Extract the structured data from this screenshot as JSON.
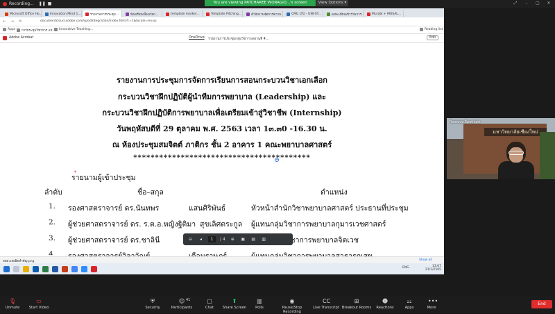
{
  "zoom": {
    "recording": "Recording...",
    "viewing_banner": "You are viewing PATCHAREE WORAGID...'s screen",
    "view_options": "View Options",
    "toolbar": [
      {
        "label": "Unmute",
        "icon": "mic-off-icon"
      },
      {
        "label": "Start Video",
        "icon": "video-off-icon"
      },
      {
        "label": "Security",
        "icon": "shield-icon"
      },
      {
        "label": "Participants",
        "icon": "people-icon",
        "count": "41"
      },
      {
        "label": "Chat",
        "icon": "chat-icon"
      },
      {
        "label": "Share Screen",
        "icon": "share-icon"
      },
      {
        "label": "Polls",
        "icon": "polls-icon"
      },
      {
        "label": "Pause/Stop Recording",
        "icon": "record-icon"
      },
      {
        "label": "Live Transcript",
        "icon": "cc-icon"
      },
      {
        "label": "Breakout Rooms",
        "icon": "breakout-icon"
      },
      {
        "label": "Reactions",
        "icon": "reactions-icon"
      },
      {
        "label": "Apps",
        "icon": "apps-icon"
      },
      {
        "label": "More",
        "icon": "more-icon"
      }
    ],
    "end": "End",
    "video_label": "Remove Spotlight",
    "video_sign": "มหาวิทยาลัยเชียงใหม่"
  },
  "browser": {
    "tabs": [
      {
        "label": "Microsoft Office Ho...",
        "color": "#d83b01"
      },
      {
        "label": "Innovation Mind 1...",
        "color": "#2b6cb0"
      },
      {
        "label": "รายงานการประชุม...",
        "color": "#d9252a"
      },
      {
        "label": "ห้องเรียนเพื่อนวัยก...",
        "color": "#7b3fa0"
      },
      {
        "label": "template marker...",
        "color": "#d9252a"
      },
      {
        "label": "Template Pitching...",
        "color": "#d9252a"
      },
      {
        "label": "สำนักงานจัดการความ...",
        "color": "#7b3fa0"
      },
      {
        "label": "CMU LTU - UNI-ST...",
        "color": "#2b6cb0"
      },
      {
        "label": "ลงทะเบียนเข้าร่วมการ...",
        "color": "#4d8e2f"
      },
      {
        "label": "Murabi + MUSAL...",
        "color": "#d9252a"
      }
    ],
    "url": "documentcloud.adobe.com/spodintegration/index.html?r=1&locale=en-us",
    "bookmarks": [
      "Apps",
      "การประชุมวิชาการ แห่...",
      "Innovative Teaching..."
    ],
    "reading_list": "Reading list"
  },
  "acrobat": {
    "app": "Adobe Acrobat",
    "location": "OneDrive",
    "filename": "รายงานการประชุมกลุ่มวิชาฯ ผลงานที่ 4...",
    "edit": "Edit",
    "page_current": "1",
    "page_total": "/ 4"
  },
  "doc": {
    "title_lines": [
      "รายงานการประชุมการจัดการเรียนการสอนกระบวนวิชาเอกเลือก",
      "กระบวนวิชาฝึกปฏิบัติผู้นำทีมการพยาบาล (Leadership) และ",
      "กระบวนวิชาฝึกปฏิบัติการพยาบาลเพื่อเตรียมเข้าสู่วิชาชีพ (Internship)",
      "วันพฤหัสบดีที่ 29 ตุลาคม พ.ศ. 2563 เวลา 1๓.๓0 -16.30 น.",
      "ณ ห้องประชุมสมจิตต์  ภาติกร ชั้น 2 อาคาร 1 คณะพยาบาลศาสตร์"
    ],
    "stars": "*****************************************",
    "attendees_heading": "รายนามผู้เข้าประชุม",
    "col_order": "ลำดับ",
    "col_name": "ชื่อ–สกุล",
    "col_position": "ตำแหน่ง",
    "rows": [
      {
        "no": "1.",
        "name": "รองศาสตราจารย์ ดร.นันทพร",
        "surname": "แสนศิริพันธ์",
        "position": "หัวหน้าสำนักวิชาพยาบาลศาสตร์   ประธานที่ประชุม"
      },
      {
        "no": "2.",
        "name": "ผู้ช่วยศาสตราจารย์  ดร. ร.ต.อ.หญิงฐิติมา",
        "surname": "สุขเลิศตระกูล",
        "position": "ผู้แทนกลุ่มวิชาการพยาบาลกุมารเวชศาสตร์"
      },
      {
        "no": "3.",
        "name": "ผู้ช่วยศาสตราจารย์  ดร.ชาลินี",
        "surname": "",
        "position": "แทนกลุ่มวิชาการพยาบาลจิตเวช"
      },
      {
        "no": "4.",
        "name": "รองศาสตราจารย์วิลาวัณย์",
        "surname": "เตือนราษฎร์",
        "position": "ผู้แทนกลุ่มวิชาการพยาบาลสาธารณสุข"
      }
    ]
  },
  "downloads": {
    "file": "ลดละเลยผิดสำคัญ.png",
    "show_all": "Show all"
  },
  "tray": {
    "time": "13:07",
    "date": "21/1/2565",
    "lang": "ENG"
  }
}
